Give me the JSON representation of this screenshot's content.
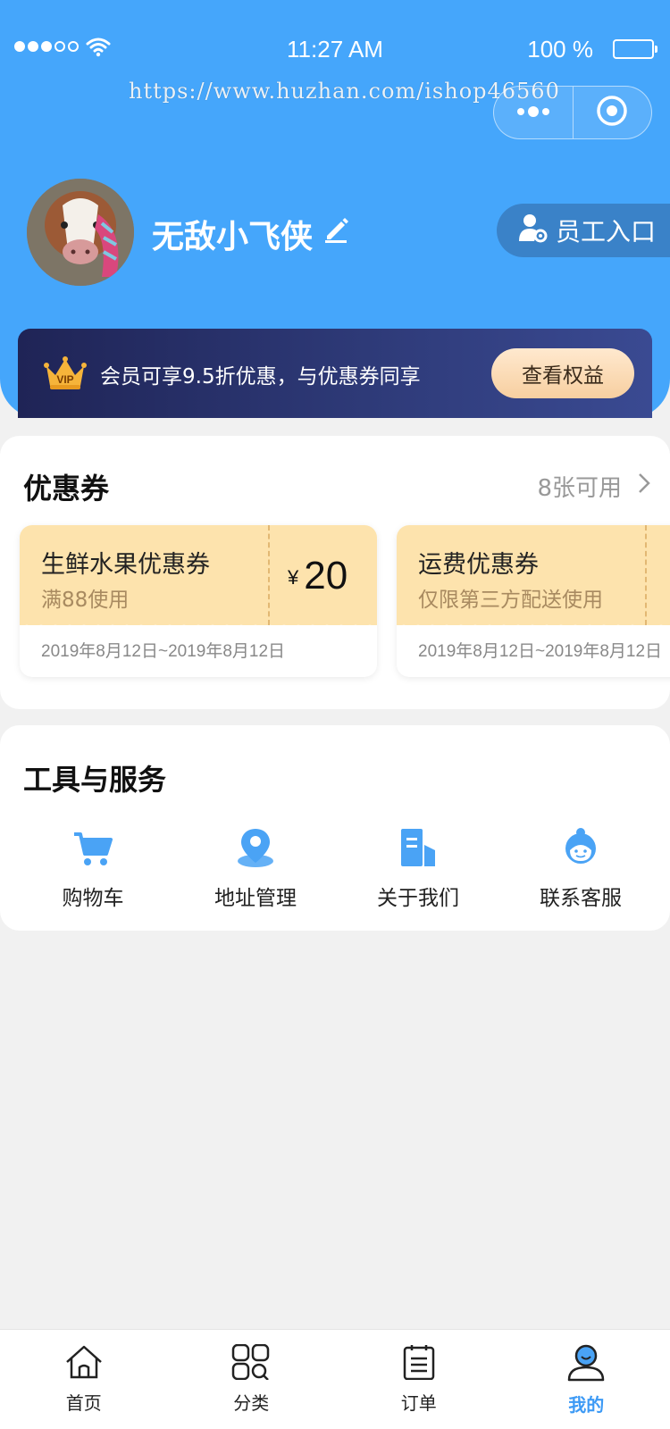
{
  "status_bar": {
    "time": "11:27 AM",
    "battery": "100 %"
  },
  "watermark": "https://www.huzhan.com/ishop46560",
  "profile": {
    "username": "无敌小飞侠",
    "staff_entry": "员工入口"
  },
  "vip": {
    "text": "会员可享9.5折优惠，与优惠券同享",
    "button": "查看权益",
    "badge": "VIP"
  },
  "coupons": {
    "title": "优惠券",
    "count": "8张可用",
    "items": [
      {
        "name": "生鲜水果优惠券",
        "condition": "满88使用",
        "currency": "¥",
        "amount": "20",
        "date": "2019年8月12日~2019年8月12日"
      },
      {
        "name": "运费优惠券",
        "condition": "仅限第三方配送使用",
        "date": "2019年8月12日~2019年8月12日"
      }
    ]
  },
  "tools": {
    "title": "工具与服务",
    "items": [
      {
        "label": "购物车",
        "icon": "cart-icon"
      },
      {
        "label": "地址管理",
        "icon": "location-icon"
      },
      {
        "label": "关于我们",
        "icon": "building-icon"
      },
      {
        "label": "联系客服",
        "icon": "customer-service-icon"
      }
    ]
  },
  "tabbar": {
    "items": [
      {
        "label": "首页",
        "icon": "home-icon"
      },
      {
        "label": "分类",
        "icon": "category-icon"
      },
      {
        "label": "订单",
        "icon": "order-icon"
      },
      {
        "label": "我的",
        "icon": "profile-icon",
        "active": true
      }
    ]
  },
  "colors": {
    "primary": "#45a6fb",
    "accent": "#3d9af5",
    "coupon_bg": "#fde3ad",
    "vip_dark": "#1f2456"
  }
}
